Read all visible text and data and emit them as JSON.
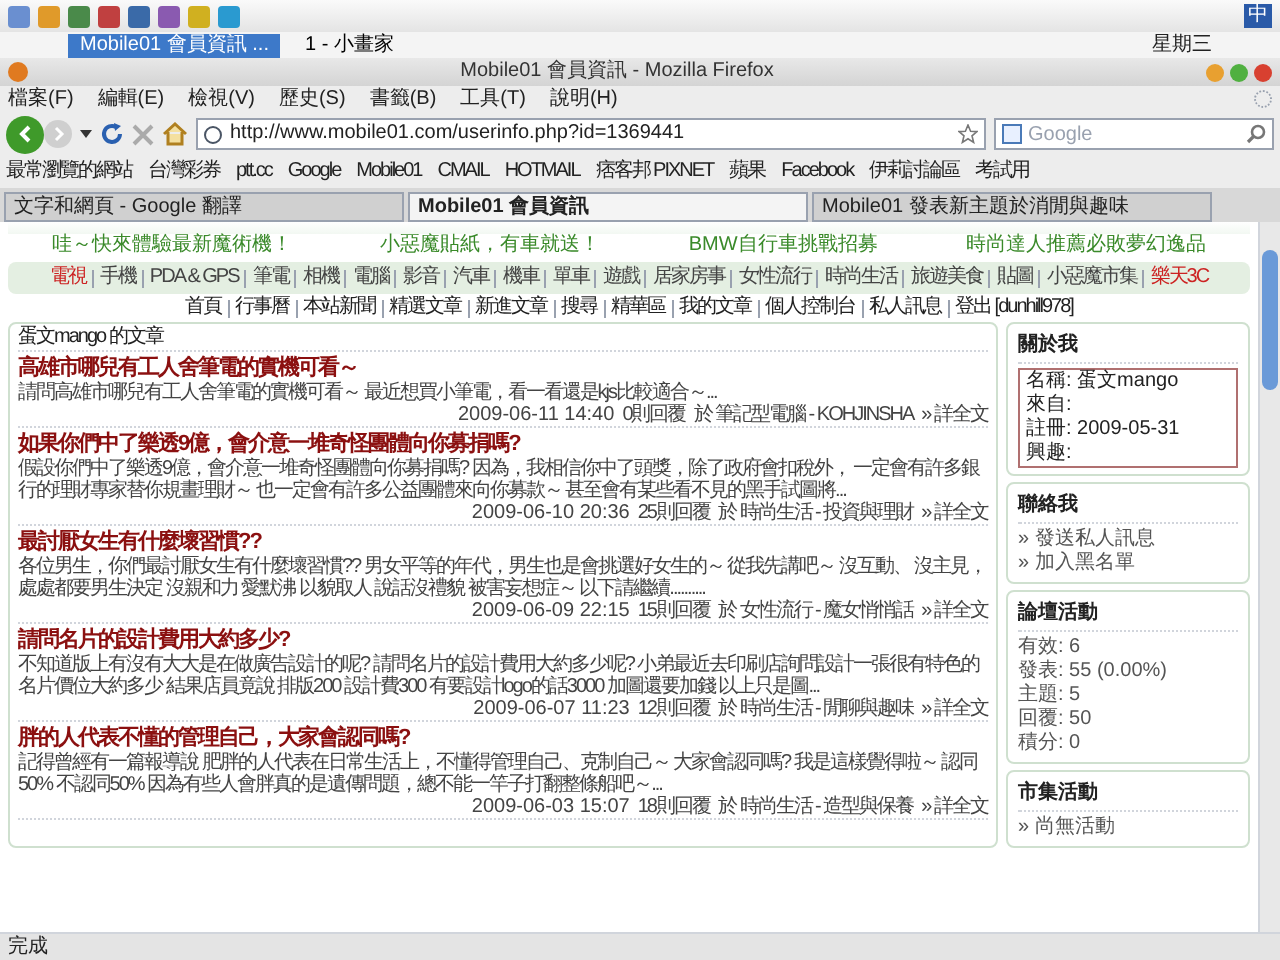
{
  "top_panel": {
    "input_method": "中"
  },
  "taskbar": {
    "tasks": [
      {
        "label": "Mobile01 會員資訊 ...",
        "selected": true
      },
      {
        "label": "1 - 小畫家",
        "selected": false
      }
    ],
    "clock": "星期三"
  },
  "window": {
    "title": "Mobile01 會員資訊 - Mozilla Firefox"
  },
  "menu": [
    "檔案(F)",
    "編輯(E)",
    "檢視(V)",
    "歷史(S)",
    "書籤(B)",
    "工具(T)",
    "說明(H)"
  ],
  "address": {
    "value": "http://www.mobile01.com/userinfo.php?id=1369441"
  },
  "search": {
    "placeholder": "Google"
  },
  "bookmarks": [
    "最常瀏覽的網站",
    "台灣彩券",
    "ptt.cc",
    "Google",
    "Mobile01",
    "CMAIL",
    "HOTMAIL",
    "痞客邦 PIXNET",
    "蘋果",
    "Facebook",
    "伊莉討論區",
    "考試用"
  ],
  "tabs": [
    {
      "label": "文字和網頁 - Google 翻譯",
      "selected": false
    },
    {
      "label": "Mobile01 會員資訊",
      "selected": true
    },
    {
      "label": "Mobile01 發表新主題於消閒與趣味",
      "selected": false
    }
  ],
  "ads": [
    "哇～快來體驗最新魔術機！",
    "小惡魔貼紙，有車就送！",
    "BMW自行車挑戰招募",
    "時尚達人推薦必敗夢幻逸品"
  ],
  "categories": [
    {
      "label": "電視",
      "color": "#cc2222"
    },
    {
      "label": "手機",
      "color": "#444444"
    },
    {
      "label": "PDA & GPS",
      "color": "#444444"
    },
    {
      "label": "筆電",
      "color": "#444444"
    },
    {
      "label": "相機",
      "color": "#444444"
    },
    {
      "label": "電腦",
      "color": "#444444"
    },
    {
      "label": "影音",
      "color": "#444444"
    },
    {
      "label": "汽車",
      "color": "#444444"
    },
    {
      "label": "機車",
      "color": "#444444"
    },
    {
      "label": "單車",
      "color": "#444444"
    },
    {
      "label": "遊戲",
      "color": "#444444"
    },
    {
      "label": "居家房事",
      "color": "#444444"
    },
    {
      "label": "女性流行",
      "color": "#444444"
    },
    {
      "label": "時尚生活",
      "color": "#444444"
    },
    {
      "label": "旅遊美食",
      "color": "#444444"
    },
    {
      "label": "貼圖",
      "color": "#444444"
    },
    {
      "label": "小惡魔市集",
      "color": "#444444"
    },
    {
      "label": "樂天3C",
      "color": "#cc2222"
    }
  ],
  "site_nav": [
    "首頁",
    "行事曆",
    "本站新聞",
    "精選文章",
    "新進文章",
    "搜尋",
    "精華區",
    "我的文章",
    "個人控制台",
    "私人訊息",
    "登出 [dunhill978]"
  ],
  "articles_heading": "蛋文mango 的文章",
  "articles": [
    {
      "title": "高雄市哪兒有工人舍筆電的實機可看～",
      "excerpt": "請問高雄市哪兒有工人舍筆電的實機可看～ 最近想買小筆電，看一看還是kjs比較適合～...",
      "posted": "2009-06-11 14:40",
      "replies": "0則回覆",
      "forum": "於 筆記型電腦 - KOHJINSHA",
      "more": "» 詳全文"
    },
    {
      "title": "如果你們中了樂透9億，會介意一堆奇怪團體向你募捐嗎?",
      "excerpt": "假設你們中了樂透9億，會介意一堆奇怪團體向你募捐嗎? 因為，我相信你中了頭獎，除了政府會扣稅外， 一定會有許多銀行的理財專家替你規畫理財～ 也一定會有許多公益團體來向你募款～ 甚至會有某些看不見的黑手試圖將...",
      "posted": "2009-06-10 20:36",
      "replies": "25則回覆",
      "forum": "於 時尚生活 - 投資與理財",
      "more": "» 詳全文"
    },
    {
      "title": "最討厭女生有什麼壞習慣??",
      "excerpt": "各位男生，你們最討厭女生有什麼壞習慣?? 男女平等的年代，男生也是會挑選好女生的～ 從我先講吧～ 沒互動、 沒主見，處處都要男生決定 沒親和力 愛默沸 以貌取人 說話沒禮貌 被害妄想症～ 以下請繼續..........",
      "posted": "2009-06-09 22:15",
      "replies": "15則回覆",
      "forum": "於 女性流行 - 魔女悄悄話",
      "more": "» 詳全文"
    },
    {
      "title": "請問名片的設計費用大約多少?",
      "excerpt": "不知道版上有沒有大大是在做廣告設計的呢? 請問名片的設計費用大約多少呢? 小弟最近去印刷店詢問設計一張很有特色的名片價位大約多少 結果店員竟說 排版200 設計費300 有要設計logo的話3000 加圖還要加錢 以上只是圖...",
      "posted": "2009-06-07 11:23",
      "replies": "12則回覆",
      "forum": "於 時尚生活 - 閒聊與趣味",
      "more": "» 詳全文"
    },
    {
      "title": "胖的人代表不懂的管理自己，大家會認同嗎?",
      "excerpt": "記得曾經有一篇報導說 肥胖的人代表在日常生活上，不懂得管理自己、克制自己～ 大家會認同嗎? 我是這樣覺得啦～ 認同50% 不認同50% 因為有些人會胖真的是遺傳問題，總不能一竿子打翻整條船吧～...",
      "posted": "2009-06-03 15:07",
      "replies": "18則回覆",
      "forum": "於 時尚生活 - 造型與保養",
      "more": "» 詳全文"
    }
  ],
  "sidebar": {
    "about": {
      "title": "關於我",
      "fields": [
        "名稱: 蛋文mango",
        "來自:",
        "註冊: 2009-05-31",
        "興趣:"
      ]
    },
    "contact": {
      "title": "聯絡我",
      "links": [
        "» 發送私人訊息",
        "» 加入黑名單"
      ]
    },
    "forum": {
      "title": "論壇活動",
      "stats": [
        "有效: 6",
        "發表: 55 (0.00%)",
        "主題: 5",
        "回覆: 50",
        "積分: 0"
      ]
    },
    "market": {
      "title": "市集活動",
      "links": [
        "» 尚無活動"
      ]
    }
  },
  "status_bar": "完成"
}
